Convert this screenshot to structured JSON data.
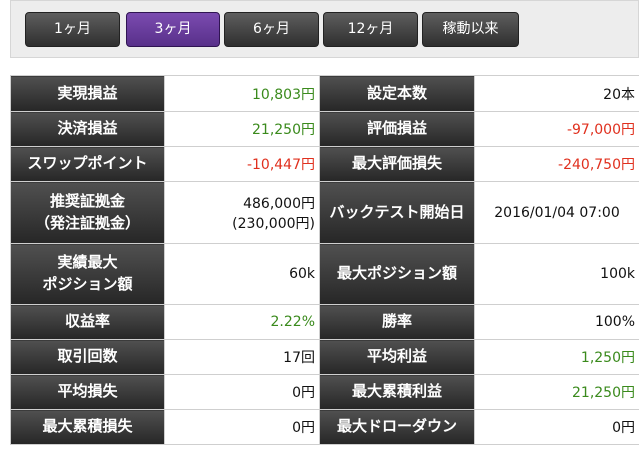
{
  "periods": [
    "1ヶ月",
    "3ヶ月",
    "6ヶ月",
    "12ヶ月",
    "稼動以来"
  ],
  "active_period": "3ヶ月",
  "stats": {
    "realized_pl": {
      "label": "実現損益",
      "value": "10,803円"
    },
    "setting_count": {
      "label": "設定本数",
      "value": "20本"
    },
    "settlement_pl": {
      "label": "決済損益",
      "value": "21,250円"
    },
    "valuation_pl": {
      "label": "評価損益",
      "value": "-97,000円"
    },
    "swap_points": {
      "label": "スワップポイント",
      "value": "-10,447円"
    },
    "max_valuation_loss": {
      "label": "最大評価損失",
      "value": "-240,750円"
    },
    "recommended_margin": {
      "label_line1": "推奨証拠金",
      "label_line2": "（発注証拠金）",
      "value_line1": "486,000円",
      "value_line2": "(230,000円)"
    },
    "backtest_start": {
      "label": "バックテスト開始日",
      "value": "2016/01/04 07:00"
    },
    "max_actual_position": {
      "label_line1": "実績最大",
      "label_line2": "ポジション額",
      "value": "60k"
    },
    "max_position": {
      "label": "最大ポジション額",
      "value": "100k"
    },
    "return_rate": {
      "label": "収益率",
      "value": "2.22%"
    },
    "win_rate": {
      "label": "勝率",
      "value": "100%"
    },
    "trade_count": {
      "label": "取引回数",
      "value": "17回"
    },
    "avg_profit": {
      "label": "平均利益",
      "value": "1,250円"
    },
    "avg_loss": {
      "label": "平均損失",
      "value": "0円"
    },
    "max_cum_profit": {
      "label": "最大累積利益",
      "value": "21,250円"
    },
    "max_cum_loss": {
      "label": "最大累積損失",
      "value": "0円"
    },
    "max_drawdown": {
      "label": "最大ドローダウン",
      "value": "0円"
    }
  },
  "colors": {
    "positive": "#3a8a1c",
    "negative": "#e0301e",
    "active_tab": "#6a3e9e"
  }
}
